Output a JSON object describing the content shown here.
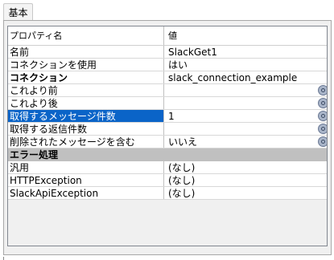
{
  "tabs": [
    {
      "label": "基本"
    }
  ],
  "grid": {
    "header": {
      "name": "プロパティ名",
      "value": "値"
    },
    "rows": [
      {
        "name": "名前",
        "value": "SlackGet1"
      },
      {
        "name": "コネクションを使用",
        "value": "はい"
      },
      {
        "name": "コネクション",
        "value": "slack_connection_example"
      },
      {
        "name": "これより前",
        "value": ""
      },
      {
        "name": "これより後",
        "value": ""
      },
      {
        "name": "取得するメッセージ件数",
        "value": "1"
      },
      {
        "name": "取得する返信件数",
        "value": ""
      },
      {
        "name": "削除されたメッセージを含む",
        "value": "いいえ"
      },
      {
        "name": "エラー処理"
      },
      {
        "name": "汎用",
        "value": "(なし)"
      },
      {
        "name": "HTTPException",
        "value": "(なし)"
      },
      {
        "name": "SlackApiException",
        "value": "(なし)"
      }
    ]
  }
}
